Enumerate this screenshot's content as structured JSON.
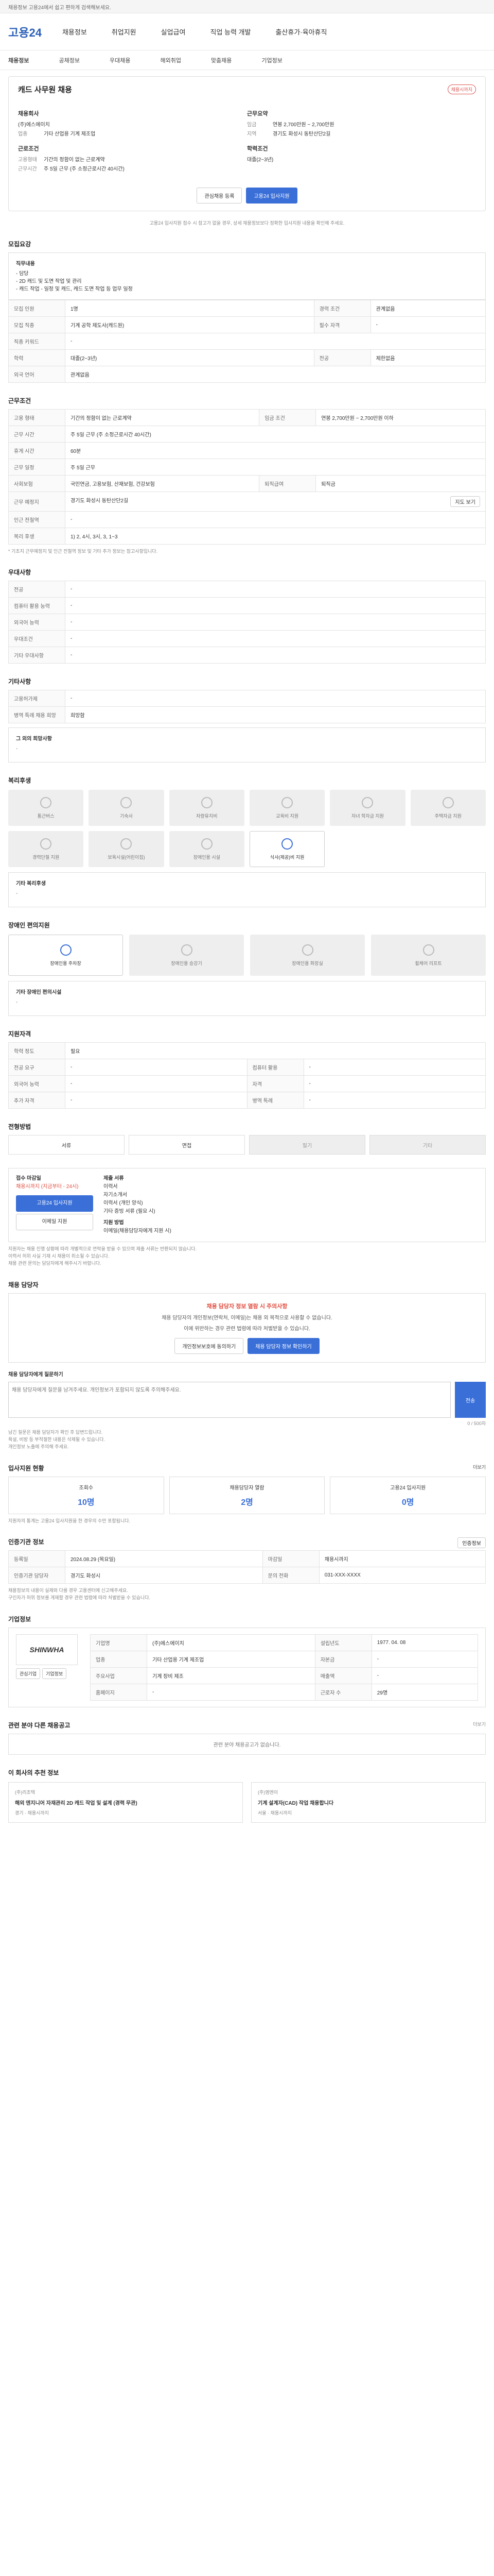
{
  "topbar": {
    "text": "채용정보 고용24에서 쉽고 편하게 검색해보세요."
  },
  "header": {
    "logo": "고용24",
    "nav": [
      "채용정보",
      "취업지원",
      "실업급여",
      "직업 능력 개발",
      "출산휴가·육아휴직"
    ]
  },
  "subnav": [
    "채용정보",
    "공채정보",
    "우대채용",
    "해외취업",
    "맞춤채용",
    "기업정보"
  ],
  "job": {
    "title": "캐드 사무원 채용",
    "badge": "채용시까지",
    "company_label": "채용회사",
    "company": "(주)에스에이치",
    "sector_label": "업종",
    "sector": "기타 산업용 기계 제조업",
    "summary_label": "근무요약",
    "salary_label": "임금",
    "salary": "연봉 2,700만원 ~ 2,700만원",
    "region_label": "지역",
    "region": "경기도 화성시 동탄산단2길",
    "cond_title": "근로조건",
    "contract_label": "고용형태",
    "contract": "기간의 정함이 없는 근로계약",
    "hours_label": "근무시간",
    "hours": "주 5일 근무 (주 소정근로시간 40시간)",
    "edu_title": "학력조건",
    "edu": "대졸(2~3년)",
    "btn_scrap": "관심채용 등록",
    "btn_apply": "고용24 입사지원",
    "apply_note": "고용24 입사지원 접수 시 참고가 없을 경우, 상세 채용정보보다 정확한 입사지원 내용을 확인해 주세요."
  },
  "recruit": {
    "title": "모집요강",
    "desc_title": "직무내용",
    "desc": [
      "- 담당",
      "- 2D 캐드 및 도면 작업 및 관리",
      "- 캐드 작업 - 일정 및 캐드, 캐드 도면 작업 등 업무 일정"
    ],
    "rows": [
      [
        "모집 인원",
        "1명",
        "경력 조건",
        "관계없음"
      ],
      [
        "모집 직종",
        "기계 공학 제도사(캐드원)",
        "필수 자격",
        "-"
      ],
      [
        "직종 키워드",
        "-",
        "",
        ""
      ],
      [
        "학력",
        "대졸(2~3년)",
        "전공",
        "제한없음"
      ],
      [
        "외국 언어",
        "관계없음",
        "",
        ""
      ]
    ]
  },
  "work": {
    "title": "근무조건",
    "rows": [
      [
        "고용 형태",
        "기간의 정함이 없는 근로계약",
        "임금 조건",
        "연봉 2,700만원 ~ 2,700만원 이하"
      ],
      [
        "근무 시간",
        "주 5일 근무 (주 소정근로시간 40시간)",
        "",
        ""
      ],
      [
        "휴게 시간",
        "60분",
        "",
        ""
      ],
      [
        "근무 일정",
        "주 5일 근무",
        "",
        ""
      ],
      [
        "사회보험",
        "국민연금, 고용보험, 산재보험, 건강보험",
        "퇴직급여",
        "퇴직금"
      ],
      [
        "근무 예정지",
        "경기도 화성시 동탄산단2길",
        "",
        ""
      ],
      [
        "인근 전철역",
        "-",
        "",
        ""
      ],
      [
        "복리 후생",
        "1) 2, 4시, 3시, 3, 1~3",
        "",
        ""
      ]
    ],
    "map_btn": "지도 보기",
    "footnote": "* 기초지 근무예정지 및 인근 전철역 정보 및 기타 추가 정보는 참고사항입니다."
  },
  "pref": {
    "title": "우대사항",
    "rows": [
      [
        "전공",
        "-"
      ],
      [
        "컴퓨터 활용 능력",
        "-"
      ],
      [
        "외국어 능력",
        "-"
      ],
      [
        "우대조건",
        "-"
      ],
      [
        "기타 우대사항",
        "-"
      ]
    ]
  },
  "etc": {
    "title": "기타사항",
    "rows": [
      [
        "고용허가제",
        "-"
      ],
      [
        "병역 특례 채용 희망",
        "희망함"
      ]
    ],
    "extra_title": "그 외의 희망사항",
    "extra": "-"
  },
  "welfare": {
    "title": "복리후생",
    "items": [
      {
        "label": "통근버스",
        "on": false
      },
      {
        "label": "기숙사",
        "on": false
      },
      {
        "label": "차량유지비",
        "on": false
      },
      {
        "label": "교육비 지원",
        "on": false
      },
      {
        "label": "자녀 학자금 지원",
        "on": false
      },
      {
        "label": "주택자금 지원",
        "on": false
      },
      {
        "label": "경력단절 지원",
        "on": false
      },
      {
        "label": "보육시설(어린이집)",
        "on": false
      },
      {
        "label": "장애인용 시설",
        "on": false
      },
      {
        "label": "식사(제공)비 지원",
        "on": true
      }
    ],
    "extra_title": "기타 복리후생",
    "extra": "-"
  },
  "disability": {
    "title": "장애인 편의지원",
    "items": [
      {
        "label": "장애인용 주차장",
        "on": true
      },
      {
        "label": "장애인용 승강기",
        "on": false
      },
      {
        "label": "장애인용 화장실",
        "on": false
      },
      {
        "label": "휠체어 리프트",
        "on": false
      }
    ],
    "extra_title": "기타 장애인 편의시설",
    "extra": "-"
  },
  "qual": {
    "title": "지원자격",
    "rows": [
      [
        "학력 정도",
        "필요",
        "",
        ""
      ],
      [
        "전공 요구",
        "-",
        "컴퓨터 활용",
        "-"
      ],
      [
        "외국어 능력",
        "-",
        "자격",
        "-"
      ],
      [
        "추가 자격",
        "-",
        "병역 특례",
        "-"
      ]
    ]
  },
  "process": {
    "title": "전형방법",
    "steps": [
      {
        "label": "서류",
        "on": true
      },
      {
        "label": "면접",
        "on": true
      },
      {
        "label": "필기",
        "on": false
      },
      {
        "label": "기타",
        "on": false
      }
    ]
  },
  "apply": {
    "method_title": "접수 마감일",
    "deadline": "채용시까지 (지금부터 - 24시)",
    "btn_apply": "고용24 입사지원",
    "btn_email": "이메일 지원",
    "doc_title": "제출 서류",
    "docs": [
      "이력서",
      "자기소개서",
      "이력서 (개인 양식)",
      "기타 증빙 서류 (필요 시)"
    ],
    "how_title": "지원 방법",
    "how": "이메일(채용담당자에게 지원 시)",
    "notes": [
      "지원자는 채용 진행 상황에 따라 개별적으로 연락을 받을 수 있으며 제출 서류는 반환되지 않습니다.",
      "이력서 허위 사실 기재 시 채용이 취소될 수 있습니다.",
      "채용 관련 문의는 담당자에게 해주시기 바랍니다."
    ]
  },
  "contact": {
    "title": "채용 담당자",
    "warn": "채용 담당자 정보 열람 시 주의사항",
    "desc": "채용 담당자의 개인정보(연락처, 이메일)는 채용 외 목적으로 사용할 수 없습니다.",
    "desc2": "이에 위반하는 경우 관련 법령에 따라 처벌받을 수 있습니다.",
    "btn_view": "개인정보보호에 동의하기",
    "btn_apply": "채용 담당자 정보 확인하기",
    "qa_title": "채용 담당자에게 질문하기",
    "qa_placeholder": "채용 담당자에게 질문을 남겨주세요. 개인정보가 포함되지 않도록 주의해주세요.",
    "qa_submit": "전송",
    "qa_count": "0 / 500자",
    "qa_notes": [
      "남긴 질문은 채용 담당자가 확인 후 답변드립니다.",
      "욕설, 비방 등 부적절한 내용은 삭제될 수 있습니다.",
      "개인정보 노출에 주의해 주세요."
    ]
  },
  "status": {
    "title": "입사지원 현황",
    "more": "더보기",
    "cards": [
      {
        "label": "조회수",
        "value": "10명"
      },
      {
        "label": "채용담당자 열람",
        "value": "2명"
      },
      {
        "label": "고용24 입사지원",
        "value": "0명"
      }
    ],
    "note": "지원자의 통계는 고용24 입사지원을 한 경우의 수만 포함됩니다."
  },
  "infos": {
    "title": "인증기관 정보",
    "btn": "인증정보",
    "rows": [
      [
        "등록일",
        "2024.08.29 (목요일)",
        "마감일",
        "채용시까지"
      ],
      [
        "인증기관 담당자",
        "경기도 화성시",
        "문의 전화",
        "031-XXX-XXXX"
      ]
    ],
    "notes": [
      "채용정보의 내용이 실제와 다를 경우 고용센터에 신고해주세요.",
      "구인자가 허위 정보를 게재할 경우 관련 법령에 따라 처벌받을 수 있습니다."
    ]
  },
  "company": {
    "title": "기업정보",
    "logo_text": "SHINWHA",
    "btn_interest": "관심기업",
    "btn_info": "기업정보",
    "rows": [
      [
        "기업명",
        "(주)에스에이치",
        "설립년도",
        "1977. 04. 08"
      ],
      [
        "업종",
        "기타 산업용 기계 제조업",
        "자본금",
        "-"
      ],
      [
        "주요사업",
        "기계 장비 제조",
        "매출액",
        "-"
      ],
      [
        "홈페이지",
        "-",
        "근로자 수",
        "29명"
      ]
    ]
  },
  "similar": {
    "title": "관련 분야 다른 채용공고",
    "more": "더보기",
    "empty": "관련 분야 채용공고가 없습니다."
  },
  "reco": {
    "title": "이 회사의 추천 정보",
    "items": [
      {
        "company": "(주)리조텍",
        "title": "해외 엔지니어 자재관리 2D 캐드 작업 및 설계 (경력 무관)",
        "meta": "경기 · 채용시까지"
      },
      {
        "company": "(주)엠엔이",
        "title": "기계 설계자(CAD) 작업 채용합니다",
        "meta": "서울 · 채용시까지"
      }
    ]
  }
}
